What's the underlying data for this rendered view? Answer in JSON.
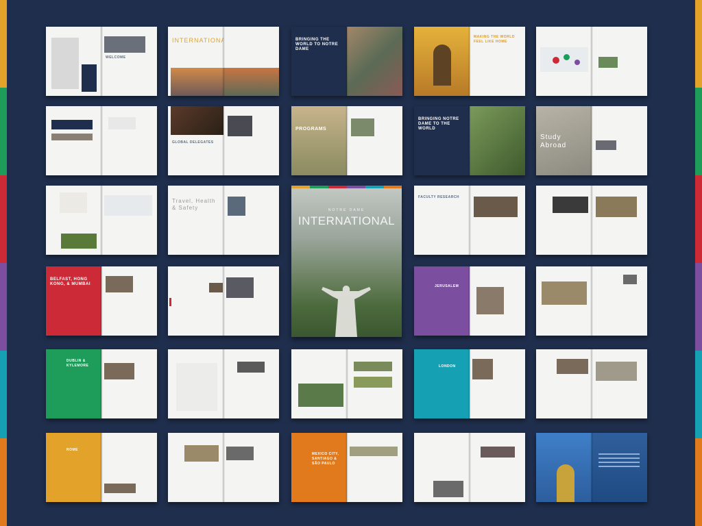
{
  "background": "#1f2e4c",
  "edge_colors": [
    "#e3a22a",
    "#1e9c5a",
    "#cc2a36",
    "#7b4ea0",
    "#16a0b4",
    "#e07a1d"
  ],
  "cover": {
    "subtitle": "NOTRE DAME",
    "title": "INTERNATIONAL",
    "colors": [
      "#e3a22a",
      "#1e9c5a",
      "#cc2a36",
      "#7b4ea0",
      "#16a0b4",
      "#e07a1d"
    ]
  },
  "spreads": [
    {
      "id": "welcome",
      "head": "WELCOME",
      "left": "#f4f4f3",
      "right": "#f4f4f3"
    },
    {
      "id": "international",
      "head": "INTERNATIONAL",
      "left": "#f4f4f3",
      "right": "#f4f4f3"
    },
    {
      "id": "bringing-world",
      "head": "BRINGING THE WORLD TO NOTRE DAME",
      "left": "#1f2e4c",
      "right": "#7b6a55"
    },
    {
      "id": "home",
      "head": "MAKING THE WORLD FEEL LIKE HOME",
      "left": "#d9a12f",
      "right": "#f4f4f3"
    },
    {
      "id": "map",
      "head": "",
      "left": "#f4f4f3",
      "right": "#f4f4f3"
    },
    {
      "id": "partners",
      "head": "",
      "left": "#f4f4f3",
      "right": "#f4f4f3"
    },
    {
      "id": "delegates",
      "head": "GLOBAL DELEGATES",
      "left": "#f4f4f3",
      "right": "#f4f4f3"
    },
    {
      "id": "programs",
      "head": "PROGRAMS",
      "left": "#c2b48f",
      "right": "#f4f4f3"
    },
    {
      "id": "bringing-nd",
      "head": "BRINGING NOTRE DAME TO THE WORLD",
      "left": "#1f2e4c",
      "right": "#5c7a42"
    },
    {
      "id": "abroad",
      "head": "Study Abroad",
      "left": "#a6a6a0",
      "right": "#f4f4f3"
    },
    {
      "id": "travel",
      "head": "Travel, Health & Safety",
      "left": "#f4f4f3",
      "right": "#f4f4f3"
    },
    {
      "id": "research",
      "head": "FACULTY RESEARCH",
      "left": "#f4f4f3",
      "right": "#f4f4f3"
    },
    {
      "id": "belfast",
      "head": "BELFAST, HONG KONG, & MUMBAI",
      "left": "#cc2a36",
      "right": "#f4f4f3"
    },
    {
      "id": "jerusalem",
      "head": "JERUSALEM",
      "left": "#7b4ea0",
      "right": "#f4f4f3"
    },
    {
      "id": "dublin",
      "head": "DUBLIN & KYLEMORE",
      "left": "#1e9c5a",
      "right": "#f4f4f3"
    },
    {
      "id": "london",
      "head": "LONDON",
      "left": "#16a0b4",
      "right": "#f4f4f3"
    },
    {
      "id": "rome",
      "head": "ROME",
      "left": "#e3a22a",
      "right": "#f4f4f3"
    },
    {
      "id": "mexico",
      "head": "MEXICO CITY, SANTIAGO & SÃO PAULO",
      "left": "#e07a1d",
      "right": "#f4f4f3"
    },
    {
      "id": "dome",
      "head": "",
      "left": "#4a7fbf",
      "right": "#2f5f9c"
    }
  ]
}
